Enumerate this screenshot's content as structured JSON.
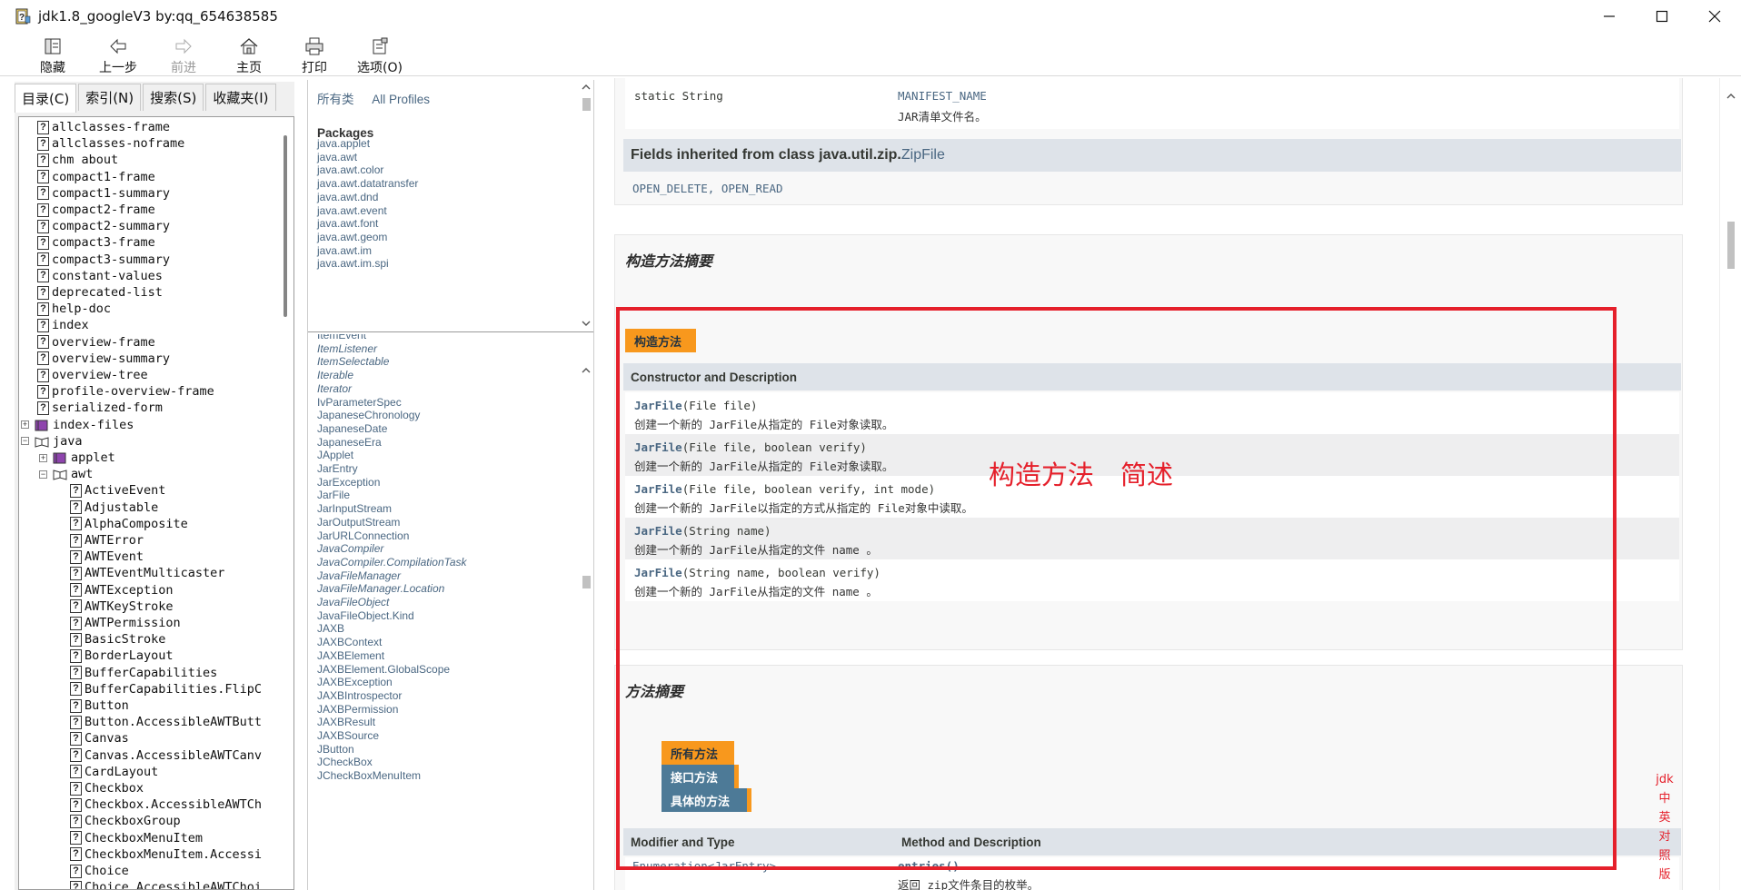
{
  "window": {
    "title": "jdk1.8_googleV3 by:qq_654638585"
  },
  "toolbar": {
    "hide": "隐藏",
    "back": "上一步",
    "forward": "前进",
    "home": "主页",
    "print": "打印",
    "options": "选项(O)"
  },
  "nav_tabs": [
    "目录(C)",
    "索引(N)",
    "搜索(S)",
    "收藏夹(I)"
  ],
  "tree": {
    "top_items": [
      "allclasses-frame",
      "allclasses-noframe",
      "chm about",
      "compact1-frame",
      "compact1-summary",
      "compact2-frame",
      "compact2-summary",
      "compact3-frame",
      "compact3-summary",
      "constant-values",
      "deprecated-list",
      "help-doc",
      "index",
      "overview-frame",
      "overview-summary",
      "overview-tree",
      "profile-overview-frame",
      "serialized-form"
    ],
    "index_files": "index-files",
    "java": "java",
    "applet": "applet",
    "awt": "awt",
    "awt_items": [
      "ActiveEvent",
      "Adjustable",
      "AlphaComposite",
      "AWTError",
      "AWTEvent",
      "AWTEventMulticaster",
      "AWTException",
      "AWTKeyStroke",
      "AWTPermission",
      "BasicStroke",
      "BorderLayout",
      "BufferCapabilities",
      "BufferCapabilities.FlipC",
      "Button",
      "Button.AccessibleAWTButt",
      "Canvas",
      "Canvas.AccessibleAWTCanv",
      "CardLayout",
      "Checkbox",
      "Checkbox.AccessibleAWTCh",
      "CheckboxGroup",
      "CheckboxMenuItem",
      "CheckboxMenuItem.Accessi",
      "Choice",
      "Choice.AccessibleAWTChoi"
    ]
  },
  "packages_frame": {
    "link_all_classes": "所有类",
    "link_all_profiles": "All Profiles",
    "heading": "Packages",
    "items": [
      "java.applet",
      "java.awt",
      "java.awt.color",
      "java.awt.datatransfer",
      "java.awt.dnd",
      "java.awt.event",
      "java.awt.font",
      "java.awt.geom",
      "java.awt.im",
      "java.awt.im.spi"
    ]
  },
  "classes_frame": {
    "items": [
      {
        "name": "ItemEvent",
        "italic": false
      },
      {
        "name": "ItemListener",
        "italic": true
      },
      {
        "name": "ItemSelectable",
        "italic": true
      },
      {
        "name": "Iterable",
        "italic": true
      },
      {
        "name": "Iterator",
        "italic": true
      },
      {
        "name": "IvParameterSpec",
        "italic": false
      },
      {
        "name": "JapaneseChronology",
        "italic": false
      },
      {
        "name": "JapaneseDate",
        "italic": false
      },
      {
        "name": "JapaneseEra",
        "italic": false
      },
      {
        "name": "JApplet",
        "italic": false
      },
      {
        "name": "JarEntry",
        "italic": false
      },
      {
        "name": "JarException",
        "italic": false
      },
      {
        "name": "JarFile",
        "italic": false
      },
      {
        "name": "JarInputStream",
        "italic": false
      },
      {
        "name": "JarOutputStream",
        "italic": false
      },
      {
        "name": "JarURLConnection",
        "italic": false
      },
      {
        "name": "JavaCompiler",
        "italic": true
      },
      {
        "name": "JavaCompiler.CompilationTask",
        "italic": true
      },
      {
        "name": "JavaFileManager",
        "italic": true
      },
      {
        "name": "JavaFileManager.Location",
        "italic": true
      },
      {
        "name": "JavaFileObject",
        "italic": true
      },
      {
        "name": "JavaFileObject.Kind",
        "italic": false
      },
      {
        "name": "JAXB",
        "italic": false
      },
      {
        "name": "JAXBContext",
        "italic": false
      },
      {
        "name": "JAXBElement",
        "italic": false
      },
      {
        "name": "JAXBElement.GlobalScope",
        "italic": false
      },
      {
        "name": "JAXBException",
        "italic": false
      },
      {
        "name": "JAXBIntrospector",
        "italic": false
      },
      {
        "name": "JAXBPermission",
        "italic": false
      },
      {
        "name": "JAXBResult",
        "italic": false
      },
      {
        "name": "JAXBSource",
        "italic": false
      },
      {
        "name": "JButton",
        "italic": false
      },
      {
        "name": "JCheckBox",
        "italic": false
      },
      {
        "name": "JCheckBoxMenuItem",
        "italic": false
      }
    ]
  },
  "content": {
    "field": {
      "modifier": "static String",
      "name": "MANIFEST_NAME",
      "desc": "JAR清单文件名。"
    },
    "inherited": {
      "label": "Fields inherited from class java.util.zip.",
      "class_link": "ZipFile",
      "fields": "OPEN_DELETE, OPEN_READ"
    },
    "constructor_section_title": "构造方法摘要",
    "constructor_tab": "构造方法",
    "constructor_header": "Constructor and Description",
    "constructors": [
      {
        "name": "JarFile",
        "params": "(File file)",
        "desc": "创建一个新的 JarFile从指定的 File对象读取。"
      },
      {
        "name": "JarFile",
        "params": "(File file, boolean verify)",
        "desc": "创建一个新的 JarFile从指定的 File对象读取。"
      },
      {
        "name": "JarFile",
        "params": "(File file, boolean verify, int mode)",
        "desc": "创建一个新的 JarFile以指定的方式从指定的 File对象中读取。"
      },
      {
        "name": "JarFile",
        "params": "(String name)",
        "desc": "创建一个新的 JarFile从指定的文件 name 。"
      },
      {
        "name": "JarFile",
        "params": "(String name, boolean verify)",
        "desc": "创建一个新的 JarFile从指定的文件 name 。"
      }
    ],
    "method_section_title": "方法摘要",
    "method_tabs": [
      "所有方法",
      "接口方法",
      "具体的方法"
    ],
    "method_header_left": "Modifier and Type",
    "method_header_right": "Method and Description",
    "method_row_type": "Enumeration<JarEntry>",
    "method_row_name": "entries()",
    "method_row_desc": "返回 zip文件条目的枚举。"
  },
  "annotations": {
    "main": "构造方法　简述",
    "side": [
      "jdk",
      "中",
      "英",
      "对",
      "照",
      "版"
    ]
  },
  "colors": {
    "accent_red": "#e5202b",
    "tab_orange": "#f8981d",
    "tab_blue": "#4d7a97",
    "link": "#4a6782",
    "header_bg": "#dee3e9"
  }
}
